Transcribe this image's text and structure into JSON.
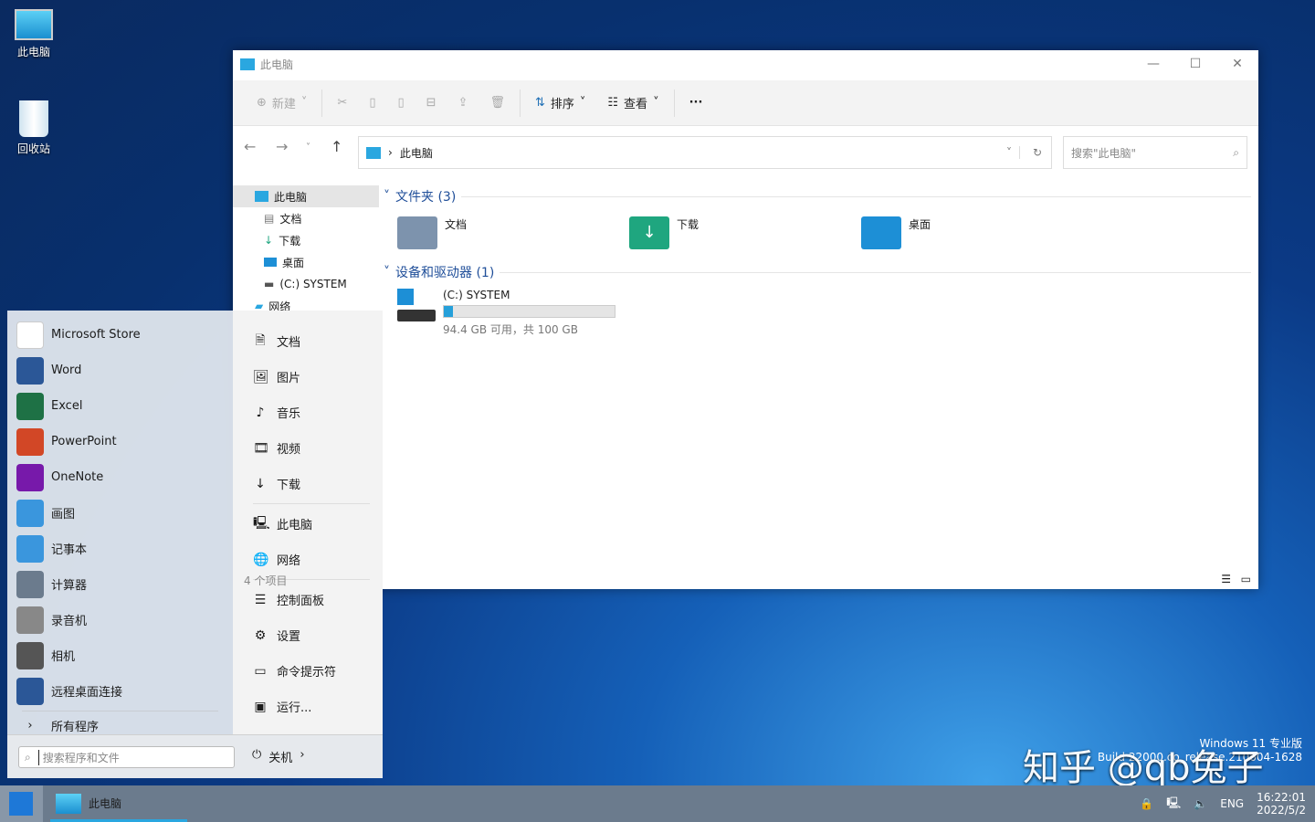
{
  "desktop": {
    "icons": [
      {
        "label": "此电脑",
        "icon": "monitor-icon"
      },
      {
        "label": "回收站",
        "icon": "recycle-bin-icon"
      }
    ]
  },
  "explorer": {
    "title": "此电脑",
    "toolbar": {
      "new": "新建",
      "sort": "排序",
      "view": "查看",
      "more": "···"
    },
    "address": {
      "crumb": "此电脑"
    },
    "search_placeholder": "搜索\"此电脑\"",
    "nav": [
      {
        "label": "此电脑",
        "selected": true
      },
      {
        "label": "文档"
      },
      {
        "label": "下载"
      },
      {
        "label": "桌面"
      },
      {
        "label": "(C:) SYSTEM"
      },
      {
        "label": "网络"
      }
    ],
    "folders_header": "文件夹 (3)",
    "folders": [
      {
        "label": "文档",
        "color": "#7d93ad"
      },
      {
        "label": "下载",
        "color": "#1fa67f"
      },
      {
        "label": "桌面",
        "color": "#1d8fd6"
      }
    ],
    "drives_header": "设备和驱动器 (1)",
    "drive": {
      "name": "(C:) SYSTEM",
      "usage_percent": 5.6,
      "free_text": "94.4 GB 可用，共 100 GB"
    },
    "status": "4 个项目"
  },
  "start_menu": {
    "apps": [
      {
        "label": "Microsoft Store",
        "icon": "store-icon",
        "color": "#ffffff"
      },
      {
        "label": "Word",
        "icon": "word-icon",
        "color": "#2b5797"
      },
      {
        "label": "Excel",
        "icon": "excel-icon",
        "color": "#1e7145"
      },
      {
        "label": "PowerPoint",
        "icon": "powerpoint-icon",
        "color": "#d24726"
      },
      {
        "label": "OneNote",
        "icon": "onenote-icon",
        "color": "#7719aa"
      },
      {
        "label": "画图",
        "icon": "paint-icon",
        "color": "#3a96dd"
      },
      {
        "label": "记事本",
        "icon": "notepad-icon",
        "color": "#3a96dd"
      },
      {
        "label": "计算器",
        "icon": "calculator-icon",
        "color": "#6b7b8d"
      },
      {
        "label": "录音机",
        "icon": "recorder-icon",
        "color": "#888"
      },
      {
        "label": "相机",
        "icon": "camera-icon",
        "color": "#555"
      },
      {
        "label": "远程桌面连接",
        "icon": "remote-desktop-icon",
        "color": "#2b5797"
      }
    ],
    "all_programs": "所有程序",
    "places": [
      {
        "label": "文档",
        "icon": "document-icon",
        "glyph": "🗎"
      },
      {
        "label": "图片",
        "icon": "picture-icon",
        "glyph": "🖼"
      },
      {
        "label": "音乐",
        "icon": "music-icon",
        "glyph": "♪"
      },
      {
        "label": "视频",
        "icon": "video-icon",
        "glyph": "🎞"
      },
      {
        "label": "下载",
        "icon": "download-icon",
        "glyph": "↓"
      },
      {
        "label": "此电脑",
        "icon": "computer-icon",
        "glyph": "🖳"
      },
      {
        "label": "网络",
        "icon": "network-icon",
        "glyph": "🌐"
      },
      {
        "label": "控制面板",
        "icon": "control-panel-icon",
        "glyph": "☰"
      },
      {
        "label": "设置",
        "icon": "settings-icon",
        "glyph": "⚙"
      },
      {
        "label": "命令提示符",
        "icon": "cmd-icon",
        "glyph": "▭"
      },
      {
        "label": "运行...",
        "icon": "run-icon",
        "glyph": "▣"
      }
    ],
    "search_placeholder": "搜索程序和文件",
    "shutdown": "关机"
  },
  "taskbar": {
    "app": "此电脑",
    "lang": "ENG",
    "time": "16:22:01",
    "date": "2022/5/2"
  },
  "watermark": {
    "brand": "知乎 @qb兔子",
    "edition": "Windows 11 专业版",
    "build": "Build 22000.co_release.210604-1628"
  }
}
